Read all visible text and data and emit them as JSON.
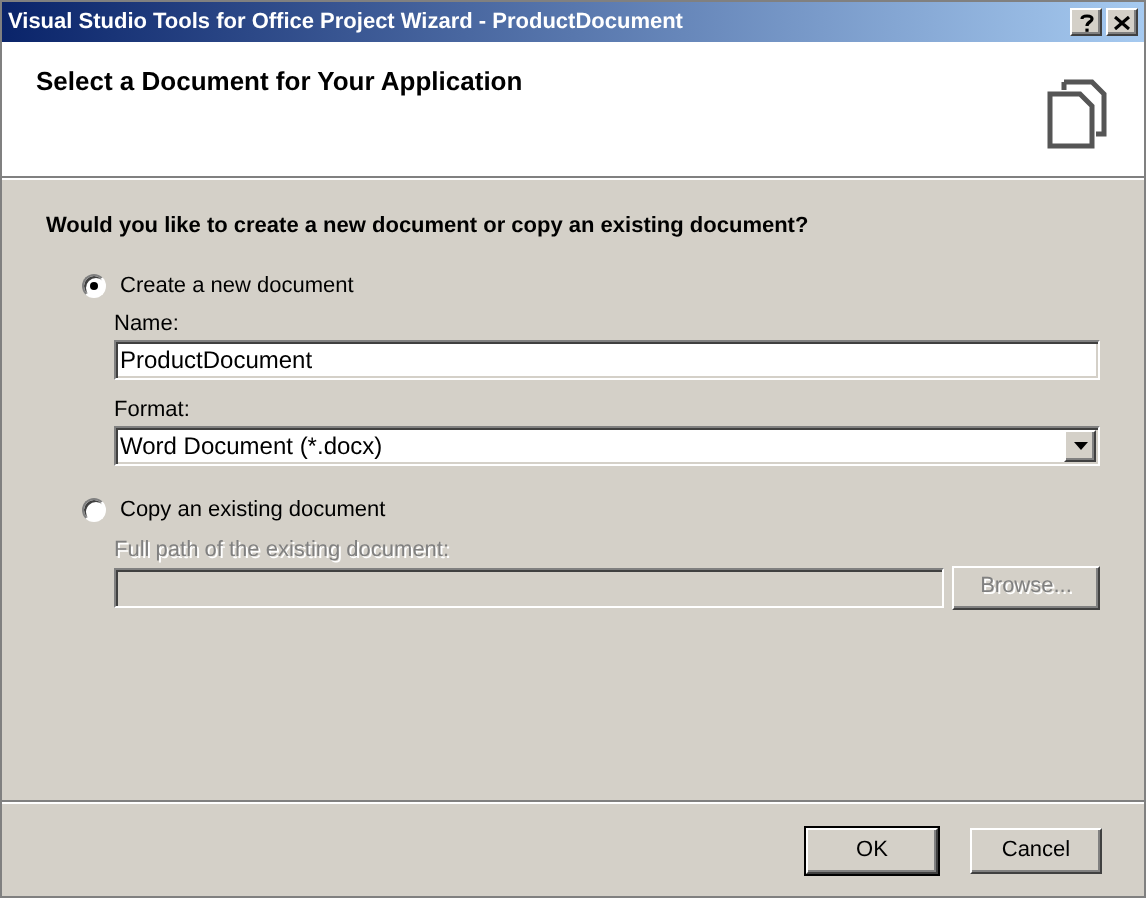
{
  "window": {
    "title": "Visual Studio Tools for Office Project Wizard - ProductDocument"
  },
  "header": {
    "title": "Select a Document for Your Application"
  },
  "question": "Would you like to create a new document or copy an existing document?",
  "options": [
    {
      "label": "Create a new document",
      "selected": true,
      "fields": [
        {
          "kind": "text",
          "label": "Name:",
          "value": "ProductDocument",
          "disabled": false
        },
        {
          "kind": "dropdown",
          "label": "Format:",
          "value": "Word Document (*.docx)",
          "disabled": false
        }
      ]
    },
    {
      "label": "Copy an existing document",
      "selected": false,
      "fields": [
        {
          "kind": "browse",
          "label": "Full path of the existing document:",
          "button": "Browse...",
          "disabled": true
        }
      ]
    }
  ],
  "buttons": [
    {
      "label": "OK",
      "default": true
    },
    {
      "label": "Cancel",
      "default": false
    }
  ]
}
